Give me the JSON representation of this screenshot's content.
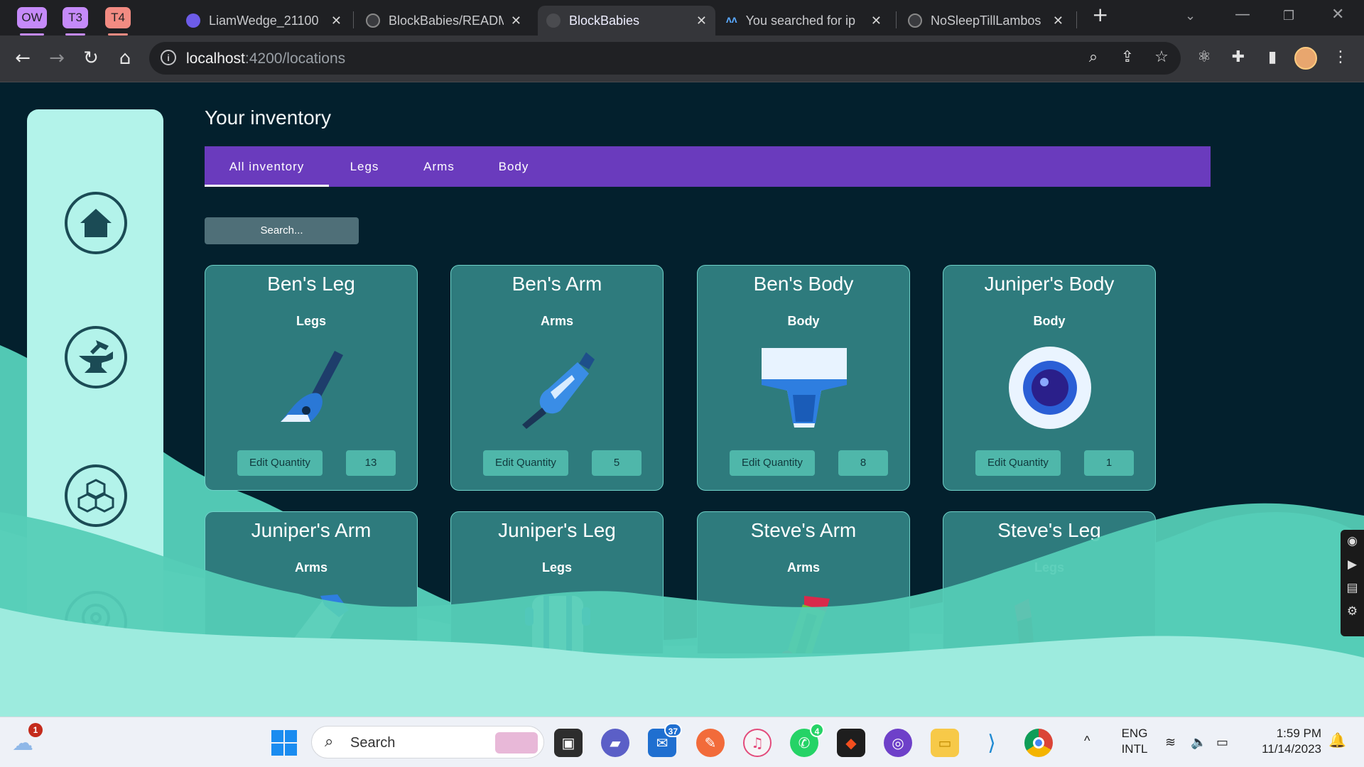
{
  "browser": {
    "tab_groups": [
      {
        "label": "OW",
        "color": "#c58af9"
      },
      {
        "label": "T3",
        "color": "#c58af9"
      },
      {
        "label": "T4",
        "color": "#f28b82"
      }
    ],
    "tabs": [
      {
        "title": "LiamWedge_21100",
        "active": false
      },
      {
        "title": "BlockBabies/READM",
        "active": false
      },
      {
        "title": "BlockBabies",
        "active": true
      },
      {
        "title": "You searched for ip",
        "active": false
      },
      {
        "title": "NoSleepTillLambos",
        "active": false
      }
    ],
    "url_host": "localhost",
    "url_path": ":4200/locations"
  },
  "page": {
    "heading": "Your inventory",
    "filter_tabs": [
      {
        "label": "All inventory",
        "active": true
      },
      {
        "label": "Legs",
        "active": false
      },
      {
        "label": "Arms",
        "active": false
      },
      {
        "label": "Body",
        "active": false
      }
    ],
    "search_placeholder": "Search...",
    "edit_label": "Edit Quantity",
    "cards": [
      {
        "name": "Ben's Leg",
        "category": "Legs",
        "quantity": "13",
        "art": "vacuum-leg-icon"
      },
      {
        "name": "Ben's Arm",
        "category": "Arms",
        "quantity": "5",
        "art": "robot-arm-icon"
      },
      {
        "name": "Ben's Body",
        "category": "Body",
        "quantity": "8",
        "art": "diaper-body-icon"
      },
      {
        "name": "Juniper's Body",
        "category": "Body",
        "quantity": "1",
        "art": "orb-body-icon"
      },
      {
        "name": "Juniper's Arm",
        "category": "Arms",
        "quantity": "",
        "art": "blue-arm-icon"
      },
      {
        "name": "Juniper's Leg",
        "category": "Legs",
        "quantity": "",
        "art": "tube-leg-icon"
      },
      {
        "name": "Steve's Arm",
        "category": "Arms",
        "quantity": "",
        "art": "green-arm-icon"
      },
      {
        "name": "Steve's Leg",
        "category": "Legs",
        "quantity": "",
        "art": "dark-leg-icon"
      }
    ]
  },
  "sidebar": {
    "items": [
      "home-icon",
      "anvil-icon",
      "blocks-icon",
      "location-pin-icon"
    ]
  },
  "taskbar": {
    "search_label": "Search",
    "weather_badge": "1",
    "mail_badge": "37",
    "whatsapp_badge": "4",
    "lang_line1": "ENG",
    "lang_line2": "INTL",
    "time": "1:59 PM",
    "date": "11/14/2023"
  },
  "colors": {
    "page_bg": "#03202d",
    "tab_bar": "#6a3bbd",
    "card_bg": "#2e7b7d",
    "wave": "#5fd3bf",
    "sidebar": "#b3f3ea"
  }
}
